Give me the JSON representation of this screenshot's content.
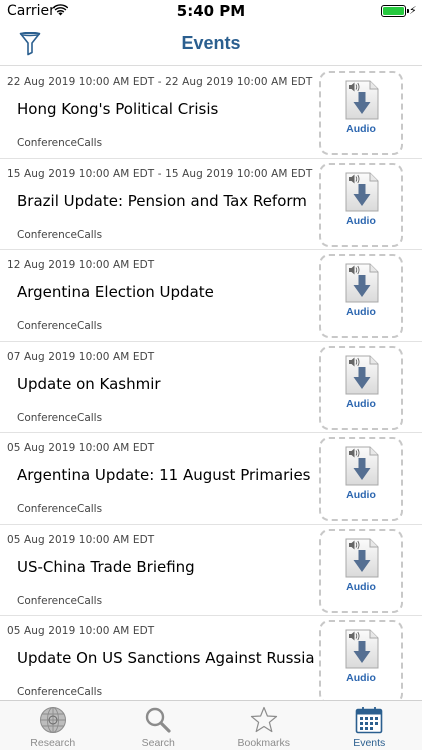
{
  "status_bar": {
    "carrier": "Carrier",
    "time": "5:40 PM",
    "battery_level": 1.0
  },
  "nav": {
    "title": "Events",
    "filter_icon": "filter-funnel-icon"
  },
  "events": [
    {
      "date": "22 Aug 2019 10:00 AM EDT - 22 Aug 2019 10:00 AM EDT",
      "title": "Hong Kong's Political Crisis",
      "source": "ConferenceCalls",
      "audio_label": "Audio"
    },
    {
      "date": "15 Aug 2019 10:00 AM EDT - 15 Aug 2019 10:00 AM EDT",
      "title": "Brazil Update: Pension and Tax Reform",
      "source": "ConferenceCalls",
      "audio_label": "Audio"
    },
    {
      "date": "12 Aug 2019 10:00 AM EDT",
      "title": "Argentina Election Update",
      "source": "ConferenceCalls",
      "audio_label": "Audio"
    },
    {
      "date": "07 Aug 2019 10:00 AM EDT",
      "title": "Update on Kashmir",
      "source": "ConferenceCalls",
      "audio_label": "Audio"
    },
    {
      "date": "05 Aug 2019 10:00 AM EDT",
      "title": "Argentina  Update: 11 August Primaries",
      "source": "ConferenceCalls",
      "audio_label": "Audio"
    },
    {
      "date": "05 Aug 2019 10:00 AM EDT",
      "title": "US-China Trade Briefing",
      "source": "ConferenceCalls",
      "audio_label": "Audio"
    },
    {
      "date": "05 Aug 2019 10:00 AM EDT",
      "title": "Update On US Sanctions Against Russia",
      "source": "ConferenceCalls",
      "audio_label": "Audio"
    }
  ],
  "tabs": [
    {
      "label": "Research",
      "icon": "globe-icon",
      "active": false
    },
    {
      "label": "Search",
      "icon": "search-icon",
      "active": false
    },
    {
      "label": "Bookmarks",
      "icon": "star-icon",
      "active": false
    },
    {
      "label": "Events",
      "icon": "calendar-icon",
      "active": true
    }
  ],
  "colors": {
    "accent": "#2b5f8f",
    "audio_label": "#2d67b0",
    "battery": "#27c93f",
    "inactive_tab": "#8c8c8c"
  }
}
